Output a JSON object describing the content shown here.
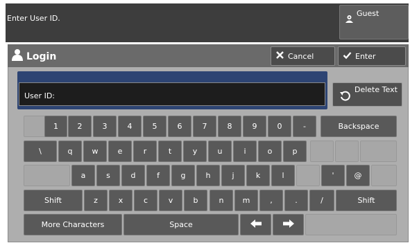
{
  "header": {
    "prompt": "Enter User ID.",
    "guest_label": "Guest",
    "guest_icon": "key-person-icon"
  },
  "dialog": {
    "title": "Login",
    "title_icon": "user-icon",
    "cancel_label": "Cancel",
    "enter_label": "Enter",
    "field_label": "User ID:",
    "field_value": "",
    "delete_label": "Delete Text"
  },
  "keyboard": {
    "row1": [
      "1",
      "2",
      "3",
      "4",
      "5",
      "6",
      "7",
      "8",
      "9",
      "0",
      "-"
    ],
    "backspace": "Backspace",
    "row2": [
      "\\",
      "q",
      "w",
      "e",
      "r",
      "t",
      "y",
      "u",
      "i",
      "o",
      "p"
    ],
    "row3": [
      "a",
      "s",
      "d",
      "f",
      "g",
      "h",
      "j",
      "k",
      "l"
    ],
    "row3_extra": [
      "'",
      "@"
    ],
    "row4": [
      "z",
      "x",
      "c",
      "v",
      "b",
      "n",
      "m",
      ",",
      "."
    ],
    "slash": "/",
    "shift": "Shift",
    "more": "More Characters",
    "space": "Space"
  },
  "colors": {
    "key": "#595959",
    "blank": "#a7a7a7",
    "field_frame": "#2d4473"
  }
}
